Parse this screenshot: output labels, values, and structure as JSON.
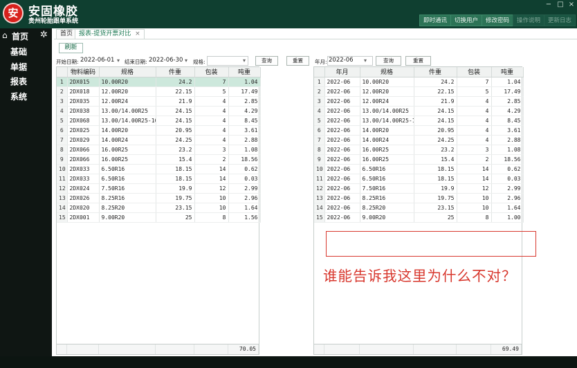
{
  "app": {
    "title": "安固橡胶",
    "subtitle": "贵州轮胎跟单系统",
    "logo_glyph": "安",
    "accent": "#0f3f30",
    "window_controls": [
      "−",
      "□",
      "×"
    ]
  },
  "header_buttons": [
    {
      "label": "即时通讯",
      "dim": false
    },
    {
      "label": "切换用户",
      "dim": false
    },
    {
      "label": "修改密码",
      "dim": false
    },
    {
      "label": "操作说明",
      "dim": true
    },
    {
      "label": "更新日志",
      "dim": true
    }
  ],
  "sidebar": {
    "home_label": "首页",
    "home_icon": "home-icon",
    "settings_icon": "gear-icon",
    "items": [
      "基础",
      "单据",
      "报表",
      "系统"
    ]
  },
  "tabs": [
    {
      "label": "首页",
      "active": false
    },
    {
      "label": "报表-提货开票对比",
      "active": true,
      "close": "×"
    }
  ],
  "toolbar": {
    "refresh_label": "刷新",
    "start_date_label": "开始日期:",
    "start_date_value": "2022-06-01",
    "end_date_label": "结束日期:",
    "end_date_value": "2022-06-30",
    "spec_label": "规格:",
    "spec_value": "",
    "query_label": "查询",
    "reset_label": "重置",
    "month_label": "年月:",
    "month_value": "2022-06",
    "query2_label": "查询",
    "reset2_label": "重置"
  },
  "left_table": {
    "columns": [
      "物料编码",
      "规格",
      "件重",
      "包装",
      "吨重"
    ],
    "rows": [
      [
        "2DX015",
        "10.00R20",
        "24.2",
        "7",
        "1.04"
      ],
      [
        "2DX018",
        "12.00R20",
        "22.15",
        "5",
        "17.49"
      ],
      [
        "2DX035",
        "12.00R24",
        "21.9",
        "4",
        "2.85"
      ],
      [
        "2DX038",
        "13.00/14.00R25",
        "24.15",
        "4",
        "4.29"
      ],
      [
        "2DX068",
        "13.00/14.00R25-10",
        "24.15",
        "4",
        "8.45"
      ],
      [
        "2DX025",
        "14.00R20",
        "20.95",
        "4",
        "3.61"
      ],
      [
        "2DX029",
        "14.00R24",
        "24.25",
        "4",
        "2.88"
      ],
      [
        "2DX066",
        "16.00R25",
        "23.2",
        "3",
        "1.08"
      ],
      [
        "2DX066",
        "16.00R25",
        "15.4",
        "2",
        "18.56"
      ],
      [
        "2DX033",
        "6.50R16",
        "18.15",
        "14",
        "0.62"
      ],
      [
        "2DX033",
        "6.50R16",
        "18.15",
        "14",
        "0.03"
      ],
      [
        "2DX024",
        "7.50R16",
        "19.9",
        "12",
        "2.99"
      ],
      [
        "2DX026",
        "8.25R16",
        "19.75",
        "10",
        "2.96"
      ],
      [
        "2DX020",
        "8.25R20",
        "23.15",
        "10",
        "1.64"
      ],
      [
        "2DX001",
        "9.00R20",
        "25",
        "8",
        "1.56"
      ]
    ],
    "total": "70.05"
  },
  "right_table": {
    "columns": [
      "年月",
      "规格",
      "件重",
      "包装",
      "吨重"
    ],
    "rows": [
      [
        "2022-06",
        "10.00R20",
        "24.2",
        "7",
        "1.04"
      ],
      [
        "2022-06",
        "12.00R20",
        "22.15",
        "5",
        "17.49"
      ],
      [
        "2022-06",
        "12.00R24",
        "21.9",
        "4",
        "2.85"
      ],
      [
        "2022-06",
        "13.00/14.00R25",
        "24.15",
        "4",
        "4.29"
      ],
      [
        "2022-06",
        "13.00/14.00R25-1",
        "24.15",
        "4",
        "8.45"
      ],
      [
        "2022-06",
        "14.00R20",
        "20.95",
        "4",
        "3.61"
      ],
      [
        "2022-06",
        "14.00R24",
        "24.25",
        "4",
        "2.88"
      ],
      [
        "2022-06",
        "16.00R25",
        "23.2",
        "3",
        "1.08"
      ],
      [
        "2022-06",
        "16.00R25",
        "15.4",
        "2",
        "18.56"
      ],
      [
        "2022-06",
        "6.50R16",
        "18.15",
        "14",
        "0.62"
      ],
      [
        "2022-06",
        "6.50R16",
        "18.15",
        "14",
        "0.03"
      ],
      [
        "2022-06",
        "7.50R16",
        "19.9",
        "12",
        "2.99"
      ],
      [
        "2022-06",
        "8.25R16",
        "19.75",
        "10",
        "2.96"
      ],
      [
        "2022-06",
        "8.25R20",
        "23.15",
        "10",
        "1.64"
      ],
      [
        "2022-06",
        "9.00R20",
        "25",
        "8",
        "1.00"
      ]
    ],
    "total": "69.49"
  },
  "annotation": {
    "text": "谁能告诉我这里为什么不对？",
    "color": "#d8382e"
  }
}
